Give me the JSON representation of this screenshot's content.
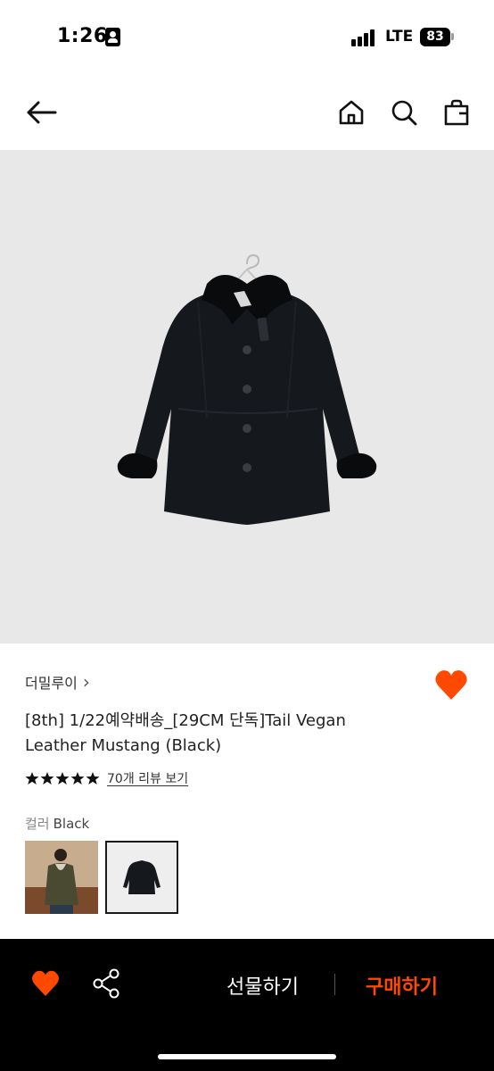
{
  "status_bar": {
    "time": "1:26",
    "network": "LTE",
    "battery": "83"
  },
  "nav": {
    "back_icon": "arrow-left-icon",
    "home_icon": "home-icon",
    "search_icon": "search-icon",
    "bag_icon": "shopping-bag-icon"
  },
  "product": {
    "brand": "더밀루이",
    "brand_chevron": "›",
    "title": "[8th] 1/22예약배송_[29CM 단독]Tail Vegan Leather Mustang (Black)",
    "stars": 5,
    "review_link": "70개 리뷰 보기",
    "color_label": "컬러",
    "color_value": "Black",
    "is_wished": true
  },
  "bottom_bar": {
    "gift_label": "선물하기",
    "buy_label": "구매하기"
  },
  "colors": {
    "accent": "#ff4800",
    "bottom_bar_bg": "#000000",
    "image_bg": "#e8e8e8"
  }
}
